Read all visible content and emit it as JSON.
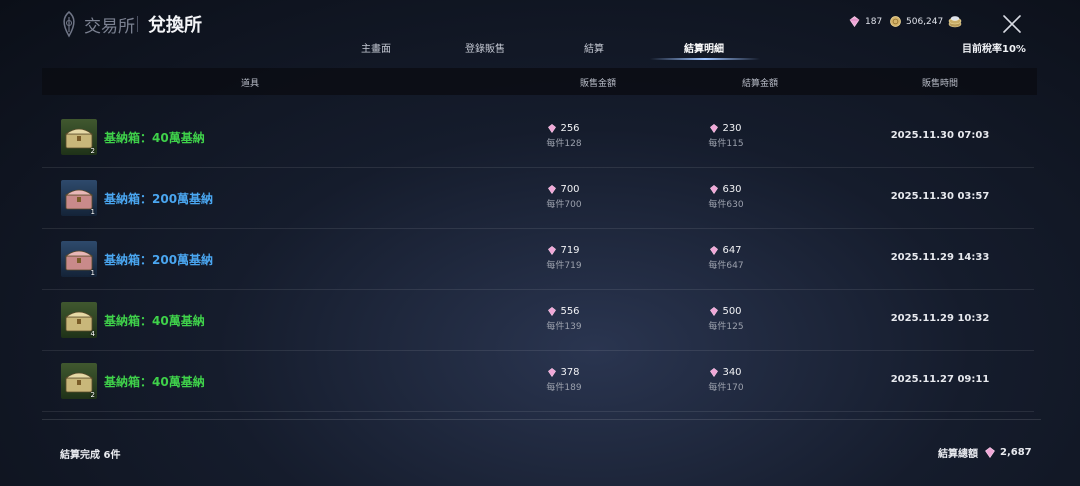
{
  "header": {
    "subtitle": "交易所",
    "title": "兌換所",
    "currency": {
      "crystal_amount": "187",
      "gold_amount": "506,247"
    },
    "logo_icon": "emblem-icon",
    "close_icon": "close-icon"
  },
  "tabs": [
    {
      "label": "主畫面",
      "active": false
    },
    {
      "label": "登錄販售",
      "active": false
    },
    {
      "label": "結算",
      "active": false
    },
    {
      "label": "結算明細",
      "active": true
    }
  ],
  "tax_rate_text": "目前稅率10%",
  "table": {
    "headers": {
      "item": "道具",
      "sale_amount": "販售金額",
      "settle_amount": "結算金額",
      "sale_time": "販售時間"
    },
    "rows": [
      {
        "name": "基納箱：40萬基納",
        "rarity": "green",
        "qty": "2",
        "sale": "256",
        "sale_each": "每件128",
        "settle": "230",
        "settle_each": "每件115",
        "time": "2025.11.30 07:03"
      },
      {
        "name": "基納箱：200萬基納",
        "rarity": "blue",
        "qty": "1",
        "sale": "700",
        "sale_each": "每件700",
        "settle": "630",
        "settle_each": "每件630",
        "time": "2025.11.30 03:57"
      },
      {
        "name": "基納箱：200萬基納",
        "rarity": "blue",
        "qty": "1",
        "sale": "719",
        "sale_each": "每件719",
        "settle": "647",
        "settle_each": "每件647",
        "time": "2025.11.29 14:33"
      },
      {
        "name": "基納箱：40萬基納",
        "rarity": "green",
        "qty": "4",
        "sale": "556",
        "sale_each": "每件139",
        "settle": "500",
        "settle_each": "每件125",
        "time": "2025.11.29 10:32"
      },
      {
        "name": "基納箱：40萬基納",
        "rarity": "green",
        "qty": "2",
        "sale": "378",
        "sale_each": "每件189",
        "settle": "340",
        "settle_each": "每件170",
        "time": "2025.11.27 09:11"
      }
    ]
  },
  "footer": {
    "completed_text": "結算完成",
    "completed_count": "6件",
    "total_label": "結算總額",
    "total_amount": "2,687"
  },
  "colors": {
    "rarity_green": "#3fd14a",
    "rarity_blue": "#4aa6f0",
    "crystal": "#f0a8d8",
    "gold": "#d4b36a"
  }
}
